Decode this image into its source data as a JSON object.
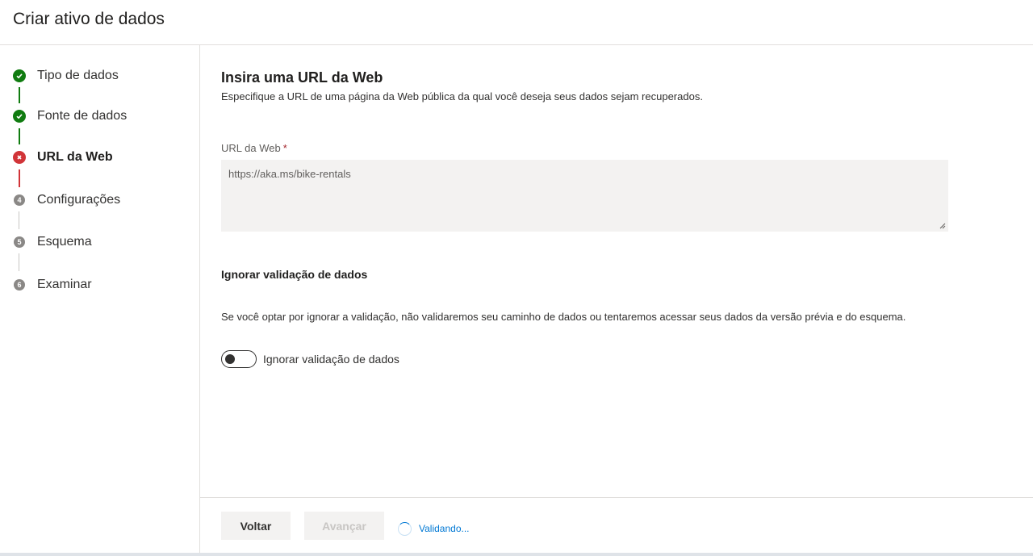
{
  "header": {
    "title": "Criar ativo de dados"
  },
  "steps": [
    {
      "label": "Tipo de dados",
      "status": "complete",
      "icon": "check-circle-icon"
    },
    {
      "label": "Fonte de dados",
      "status": "complete",
      "icon": "check-circle-icon"
    },
    {
      "label": "URL da Web",
      "status": "error",
      "icon": "error-circle-icon"
    },
    {
      "label": "Configurações",
      "status": "pending",
      "number": "4"
    },
    {
      "label": "Esquema",
      "status": "pending",
      "number": "5"
    },
    {
      "label": "Examinar",
      "status": "pending",
      "number": "6"
    }
  ],
  "main": {
    "title": "Insira uma URL da Web",
    "description": "Especifique a URL de uma página da Web pública da qual você deseja seus dados sejam recuperados.",
    "url_field": {
      "label": "URL da Web",
      "required_marker": "*",
      "value": "https://aka.ms/bike-rentals"
    },
    "skip_validation": {
      "title": "Ignorar validação de dados",
      "description": "Se você optar por ignorar a validação, não validaremos seu caminho de dados ou tentaremos acessar seus dados da versão prévia e do esquema.",
      "toggle_label": "Ignorar validação de dados",
      "toggle_on": false
    }
  },
  "footer": {
    "back_label": "Voltar",
    "next_label": "Avançar",
    "status_text": "Validando..."
  },
  "colors": {
    "complete": "#107c10",
    "error": "#d13438",
    "pending": "#8a8886",
    "accent": "#0078d4"
  }
}
